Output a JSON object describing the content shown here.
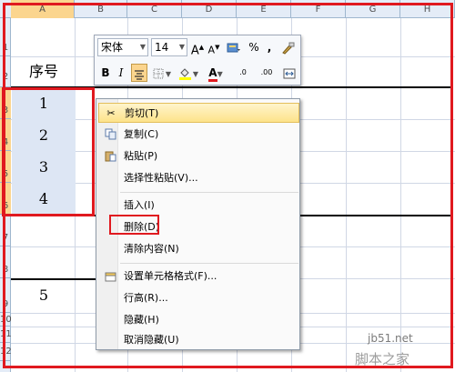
{
  "columns": [
    "A",
    "B",
    "C",
    "D",
    "E",
    "F",
    "G",
    "H"
  ],
  "rows": [
    "1",
    "2",
    "3",
    "4",
    "5",
    "6",
    "7",
    "8",
    "9",
    "10",
    "11",
    "12"
  ],
  "cells": {
    "header": "序号",
    "values": [
      "1",
      "2",
      "3",
      "4"
    ],
    "row9": "5"
  },
  "minibar": {
    "font_name": "宋体",
    "font_size": "14",
    "grow_font": "A",
    "shrink_font": "A",
    "percent": "%",
    "comma": ",",
    "bold": "B",
    "italic": "I",
    "font_color": "A",
    "inc_decimal": ".0",
    "dec_decimal": ".00"
  },
  "context_menu": {
    "items": [
      {
        "label": "剪切(T)",
        "icon": "scissors-icon"
      },
      {
        "label": "复制(C)",
        "icon": "copy-icon"
      },
      {
        "label": "粘贴(P)",
        "icon": "paste-icon"
      },
      {
        "label": "选择性粘贴(V)..."
      },
      {
        "label": "插入(I)"
      },
      {
        "label": "删除(D)"
      },
      {
        "label": "清除内容(N)"
      },
      {
        "label": "设置单元格格式(F)...",
        "icon": "format-cells-icon"
      },
      {
        "label": "行高(R)..."
      },
      {
        "label": "隐藏(H)"
      },
      {
        "label": "取消隐藏(U)"
      }
    ]
  },
  "watermark": {
    "site": "jb51.net",
    "name": "脚本之家"
  },
  "colors": {
    "annotation_red": "#e0191f",
    "selection_blue": "#dde6f4",
    "header_orange": "#fbd58e"
  }
}
